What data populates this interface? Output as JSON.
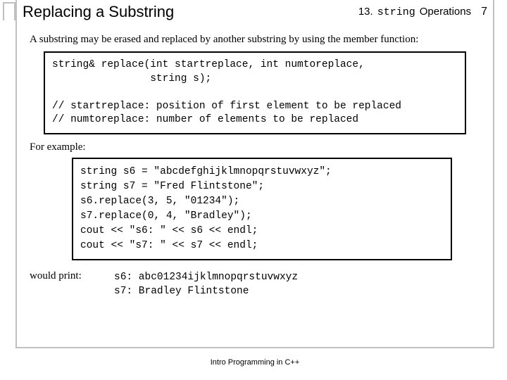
{
  "header": {
    "title": "Replacing a Substring",
    "chapter_num": "13.",
    "chapter_code": "string",
    "chapter_word": "Operations",
    "page_num": "7"
  },
  "intro": "A substring may be erased and replaced by another substring by using the member function:",
  "signature": "string& replace(int startreplace, int numtoreplace,\n                string s);\n\n// startreplace: position of first element to be replaced\n// numtoreplace: number of elements to be replaced",
  "for_example": "For example:",
  "example_code": "string s6 = \"abcdefghijklmnopqrstuvwxyz\";\nstring s7 = \"Fred Flintstone\";\ns6.replace(3, 5, \"01234\");\ns7.replace(0, 4, \"Bradley\");\ncout << \"s6: \" << s6 << endl;\ncout << \"s7: \" << s7 << endl;",
  "would_print": "would print:",
  "output": "s6: abc01234ijklmnopqrstuvwxyz\ns7: Bradley Flintstone",
  "footer": "Intro Programming in C++"
}
